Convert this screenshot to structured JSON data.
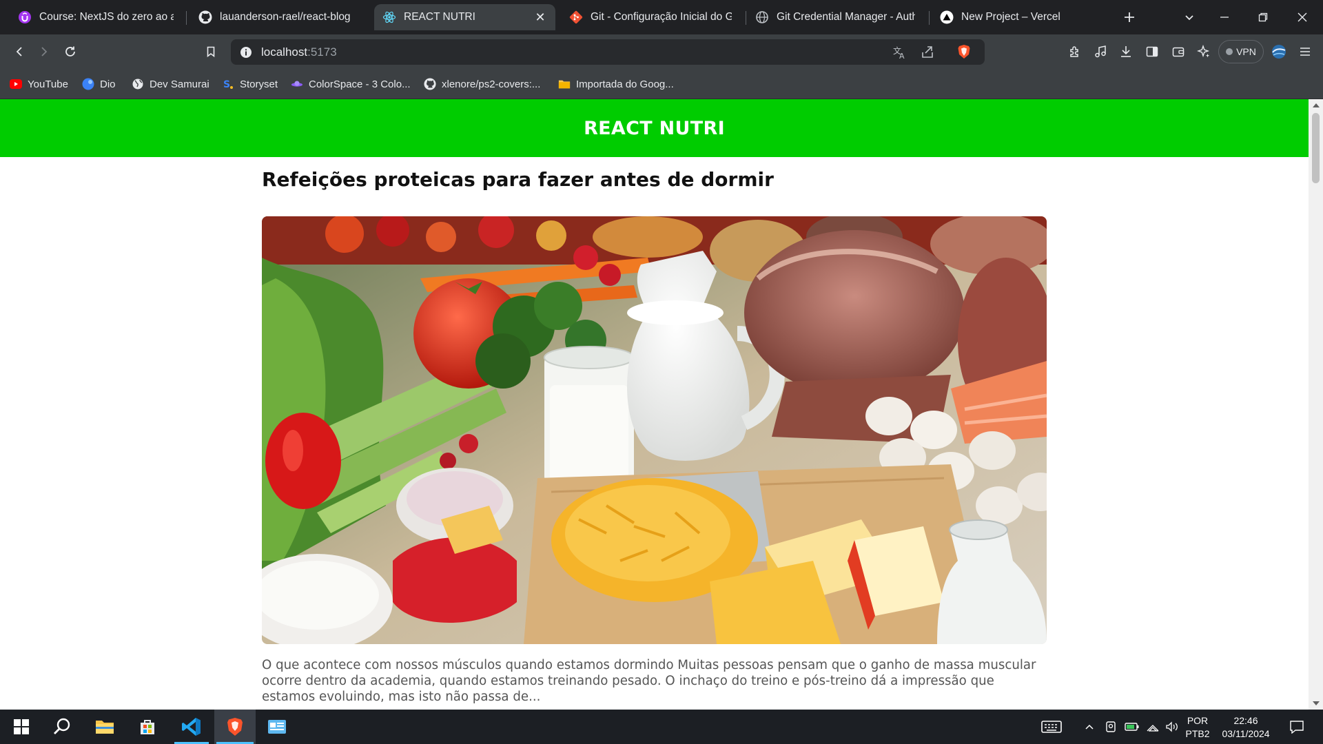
{
  "browser": {
    "tabs": [
      {
        "title": "Course: NextJS do zero ao avan",
        "icon": "udemy-icon",
        "active": false
      },
      {
        "title": "lauanderson-rael/react-blog",
        "icon": "github-icon",
        "active": false
      },
      {
        "title": "REACT NUTRI",
        "icon": "react-icon",
        "active": true
      },
      {
        "title": "Git - Configuração Inicial do Git",
        "icon": "git-icon",
        "active": false
      },
      {
        "title": "Git Credential Manager - Authe",
        "icon": "globe-icon",
        "active": false
      },
      {
        "title": "New Project – Vercel",
        "icon": "vercel-icon",
        "active": false
      }
    ],
    "address": {
      "host": "localhost",
      "port": ":5173"
    },
    "vpn_label": "VPN",
    "bookmarks": [
      {
        "label": "YouTube",
        "icon": "youtube-icon"
      },
      {
        "label": "Dio",
        "icon": "dio-icon"
      },
      {
        "label": "Dev Samurai",
        "icon": "globe-icon"
      },
      {
        "label": "Storyset",
        "icon": "storyset-icon"
      },
      {
        "label": "ColorSpace - 3 Colo...",
        "icon": "colorspace-icon"
      },
      {
        "label": "xlenore/ps2-covers:...",
        "icon": "github-icon"
      },
      {
        "label": "Importada do Goog...",
        "icon": "folder-icon"
      }
    ]
  },
  "page": {
    "header_title": "REACT NUTRI",
    "header_color": "#00cc00",
    "post": {
      "title": "Refeições proteicas para fazer antes de dormir",
      "description": "O que acontece com nossos músculos quando estamos dormindo Muitas pessoas pensam que o ganho de massa muscular ocorre dentro da academia, quando estamos treinando pesado. O inchaço do treino e pós-treino dá a impressão que estamos evoluindo, mas isto não passa de..."
    }
  },
  "taskbar": {
    "apps": [
      "start-icon",
      "search-icon",
      "file-explorer-icon",
      "microsoft-store-icon",
      "vscode-icon",
      "brave-icon",
      "control-panel-icon"
    ],
    "language": "POR",
    "layout": "PTB2",
    "time": "22:46",
    "date": "03/11/2024"
  }
}
